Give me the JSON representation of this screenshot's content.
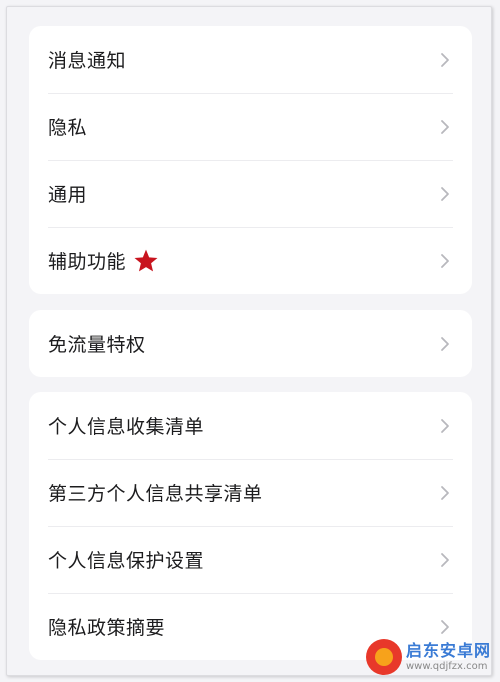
{
  "groups": [
    {
      "items": [
        {
          "label": "消息通知",
          "starred": false
        },
        {
          "label": "隐私",
          "starred": false
        },
        {
          "label": "通用",
          "starred": false
        },
        {
          "label": "辅助功能",
          "starred": true
        }
      ]
    },
    {
      "items": [
        {
          "label": "免流量特权",
          "starred": false
        }
      ]
    },
    {
      "items": [
        {
          "label": "个人信息收集清单",
          "starred": false
        },
        {
          "label": "第三方个人信息共享清单",
          "starred": false
        },
        {
          "label": "个人信息保护设置",
          "starred": false
        },
        {
          "label": "隐私政策摘要",
          "starred": false
        }
      ]
    }
  ],
  "watermark": {
    "name": "启东安卓网",
    "url": "www.qdjfzx.com"
  },
  "colors": {
    "background": "#f4f4f7",
    "card": "#ffffff",
    "text": "#1c1c1e",
    "chevron": "#b8b8bd",
    "star": "#c8141e"
  },
  "icons": {
    "row_arrow": "chevron-right-icon",
    "highlight": "star-icon"
  }
}
